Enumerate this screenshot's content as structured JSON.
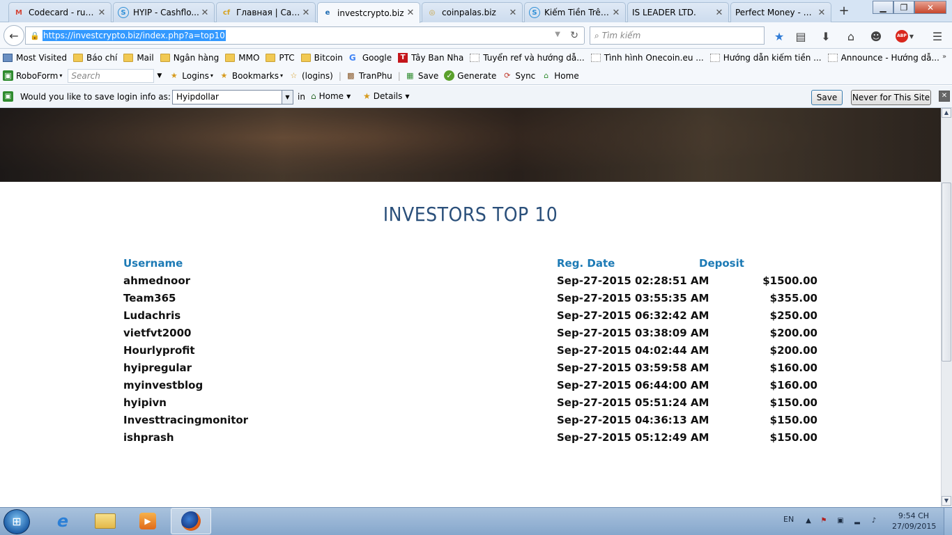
{
  "browser": {
    "tabs": [
      {
        "label": "Codecard - ruo...",
        "icon": "gmail-icon",
        "icon_char": "M",
        "icon_color": "#d44638",
        "active": false
      },
      {
        "label": "HYIP - Cashflo...",
        "icon": "s-circle-icon",
        "icon_char": "S",
        "icon_color": "#2f8fd6",
        "active": false
      },
      {
        "label": "Главная | Cash...",
        "icon": "cf-icon",
        "icon_char": "cf",
        "icon_color": "#d6a21e",
        "active": false
      },
      {
        "label": "investcrypto.biz",
        "icon": "investcrypto-icon",
        "icon_char": "e",
        "icon_color": "#1d6bb3",
        "active": true
      },
      {
        "label": "coinpalas.biz",
        "icon": "coin-icon",
        "icon_char": "◎",
        "icon_color": "#c8a03a",
        "active": false
      },
      {
        "label": "Kiếm Tiền Trên...",
        "icon": "s-circle-icon",
        "icon_char": "S",
        "icon_color": "#2f8fd6",
        "active": false
      },
      {
        "label": "IS LEADER LTD.",
        "icon": "",
        "icon_char": "",
        "icon_color": "#999999",
        "active": false
      },
      {
        "label": "Perfect Money - W...",
        "icon": "",
        "icon_char": "",
        "icon_color": "#999999",
        "active": false
      }
    ],
    "url": "https://investcrypto.biz/index.php?a=top10",
    "search_placeholder": "Tìm kiếm",
    "window_buttons": {
      "minimize": "▁",
      "restore": "❐",
      "close": "✕"
    }
  },
  "bookmarks": [
    {
      "label": "Most Visited",
      "type": "special"
    },
    {
      "label": "Báo chí",
      "type": "folder"
    },
    {
      "label": "Mail",
      "type": "folder"
    },
    {
      "label": "Ngân hàng",
      "type": "folder"
    },
    {
      "label": "MMO",
      "type": "folder"
    },
    {
      "label": "PTC",
      "type": "folder"
    },
    {
      "label": "Bitcoin",
      "type": "folder"
    },
    {
      "label": "Google",
      "type": "google"
    },
    {
      "label": "Tây Ban Nha",
      "type": "t-logo"
    },
    {
      "label": "Tuyển ref và hướng dẫ...",
      "type": "page"
    },
    {
      "label": "Tình hình Onecoin.eu ...",
      "type": "page"
    },
    {
      "label": "Hướng dẫn kiếm tiền ...",
      "type": "page"
    },
    {
      "label": "Announce - Hướng dẫ...",
      "type": "page"
    }
  ],
  "roboform": {
    "brand": "RoboForm",
    "search_placeholder": "Search",
    "logins": "Logins",
    "bookmarks": "Bookmarks",
    "logins_paren": "(logins)",
    "tranphu": "TranPhu",
    "save": "Save",
    "generate": "Generate",
    "sync": "Sync",
    "home": "Home"
  },
  "savebar": {
    "prompt": "Would you like to save login info as:",
    "selected_login": "Hyipdollar",
    "in_label": "in",
    "folder": "Home",
    "details": "Details",
    "save_button": "Save",
    "never_button": "Never for This Site",
    "close": "✕"
  },
  "page": {
    "title": "INVESTORS TOP 10",
    "columns": {
      "username": "Username",
      "reg_date": "Reg. Date",
      "deposit": "Deposit"
    },
    "rows": [
      {
        "username": "ahmednoor",
        "reg_date": "Sep-27-2015 02:28:51 AM",
        "deposit": "$1500.00"
      },
      {
        "username": "Team365",
        "reg_date": "Sep-27-2015 03:55:35 AM",
        "deposit": "$355.00"
      },
      {
        "username": "Ludachris",
        "reg_date": "Sep-27-2015 06:32:42 AM",
        "deposit": "$250.00"
      },
      {
        "username": "vietfvt2000",
        "reg_date": "Sep-27-2015 03:38:09 AM",
        "deposit": "$200.00"
      },
      {
        "username": "Hourlyprofit",
        "reg_date": "Sep-27-2015 04:02:44 AM",
        "deposit": "$200.00"
      },
      {
        "username": "hyipregular",
        "reg_date": "Sep-27-2015 03:59:58 AM",
        "deposit": "$160.00"
      },
      {
        "username": "myinvestblog",
        "reg_date": "Sep-27-2015 06:44:00 AM",
        "deposit": "$160.00"
      },
      {
        "username": "hyipivn",
        "reg_date": "Sep-27-2015 05:51:24 AM",
        "deposit": "$150.00"
      },
      {
        "username": "Investtracingmonitor",
        "reg_date": "Sep-27-2015 04:36:13 AM",
        "deposit": "$150.00"
      },
      {
        "username": "ishprash",
        "reg_date": "Sep-27-2015 05:12:49 AM",
        "deposit": "$150.00"
      }
    ],
    "colors": {
      "title": "#2a4f7a",
      "header": "#1c7ab5"
    }
  },
  "taskbar": {
    "apps": [
      "internet-explorer-icon",
      "file-explorer-icon",
      "media-player-icon",
      "firefox-icon"
    ],
    "language": "EN",
    "time": "9:54 CH",
    "date": "27/09/2015"
  }
}
